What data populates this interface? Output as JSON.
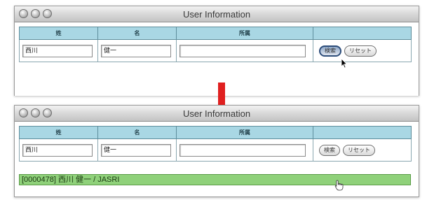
{
  "windows": [
    {
      "title": "User Information",
      "columns": [
        "姓",
        "名",
        "所属",
        ""
      ],
      "fields": {
        "last_name": "西川",
        "first_name": "健一",
        "affiliation": ""
      },
      "buttons": {
        "search": "検索",
        "reset": "リセット"
      }
    },
    {
      "title": "User Information",
      "columns": [
        "姓",
        "名",
        "所属",
        ""
      ],
      "fields": {
        "last_name": "西川",
        "first_name": "健一",
        "affiliation": ""
      },
      "buttons": {
        "search": "検索",
        "reset": "リセット"
      },
      "result_text": "[0000478] 西川 健一 / JASRI"
    }
  ],
  "colors": {
    "header_bg": "#a9d7e4",
    "result_bg": "#8fd17a",
    "arrow": "#e02020"
  },
  "icons": [
    "traffic-light-icon",
    "mouse-pointer-icon",
    "hand-cursor-icon",
    "arrow-down-icon"
  ]
}
